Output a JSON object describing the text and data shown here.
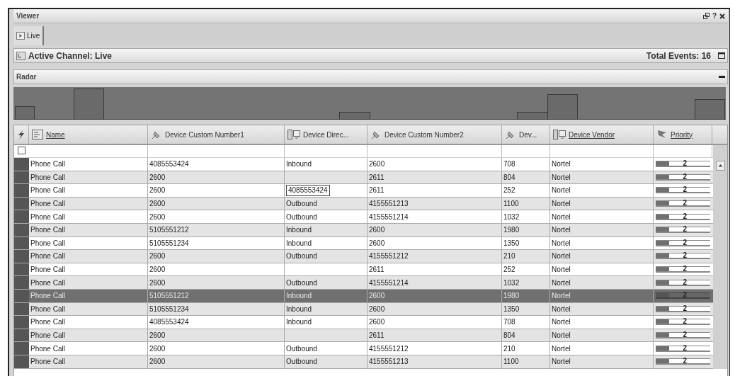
{
  "window": {
    "title": "Viewer",
    "help": "?"
  },
  "tabs": [
    {
      "label": "Live",
      "selected": true
    }
  ],
  "channel_bar": {
    "label": "Active Channel: Live",
    "total": "Total Events: 16"
  },
  "radar": {
    "title": "Radar"
  },
  "table": {
    "columns": [
      {
        "label": "Name",
        "kind": "event",
        "linked": true
      },
      {
        "label": "Device Custom Number1",
        "kind": "custom",
        "linked": false
      },
      {
        "label": "Device Direc...",
        "kind": "device",
        "linked": false
      },
      {
        "label": "Device Custom Number2",
        "kind": "custom",
        "linked": false
      },
      {
        "label": "Dev...",
        "kind": "custom",
        "linked": false
      },
      {
        "label": "Device Vendor",
        "kind": "device",
        "linked": true
      },
      {
        "label": "Priority",
        "kind": "priority",
        "linked": true
      }
    ],
    "filter_row": {
      "checked": false
    },
    "rows": [
      {
        "cells": [
          "Phone Call",
          "4085553424",
          "Inbound",
          "2600",
          "708",
          "Nortel"
        ],
        "priority": {
          "level": 0.25,
          "reading": "2"
        },
        "selected": false,
        "editing": false
      },
      {
        "cells": [
          "Phone Call",
          "2600",
          "",
          "2611",
          "804",
          "Nortel"
        ],
        "priority": {
          "level": 0.25,
          "reading": "2"
        },
        "selected": false,
        "editing": false
      },
      {
        "cells": [
          "Phone Call",
          "2600",
          "4085553424",
          "2611",
          "252",
          "Nortel"
        ],
        "priority": {
          "level": 0.25,
          "reading": "2"
        },
        "selected": false,
        "editing": true
      },
      {
        "cells": [
          "Phone Call",
          "2600",
          "Outbound",
          "4155551213",
          "1100",
          "Nortel"
        ],
        "priority": {
          "level": 0.25,
          "reading": "2"
        },
        "selected": false,
        "editing": false
      },
      {
        "cells": [
          "Phone Call",
          "2600",
          "Outbound",
          "4155551214",
          "1032",
          "Nortel"
        ],
        "priority": {
          "level": 0.25,
          "reading": "2"
        },
        "selected": false,
        "editing": false
      },
      {
        "cells": [
          "Phone Call",
          "5105551212",
          "Inbound",
          "2600",
          "1980",
          "Nortel"
        ],
        "priority": {
          "level": 0.25,
          "reading": "2"
        },
        "selected": false,
        "editing": false
      },
      {
        "cells": [
          "Phone Call",
          "5105551234",
          "Inbound",
          "2600",
          "1350",
          "Nortel"
        ],
        "priority": {
          "level": 0.25,
          "reading": "2"
        },
        "selected": false,
        "editing": false
      },
      {
        "cells": [
          "Phone Call",
          "2600",
          "Outbound",
          "4155551212",
          "210",
          "Nortel"
        ],
        "priority": {
          "level": 0.25,
          "reading": "2"
        },
        "selected": false,
        "editing": false
      },
      {
        "cells": [
          "Phone Call",
          "2600",
          "",
          "2611",
          "252",
          "Nortel"
        ],
        "priority": {
          "level": 0.25,
          "reading": "2"
        },
        "selected": false,
        "editing": false
      },
      {
        "cells": [
          "Phone Call",
          "2600",
          "Outbound",
          "4155551214",
          "1032",
          "Nortel"
        ],
        "priority": {
          "level": 0.25,
          "reading": "2"
        },
        "selected": false,
        "editing": false
      },
      {
        "cells": [
          "Phone Call",
          "5105551212",
          "Inbound",
          "2600",
          "1980",
          "Nortel"
        ],
        "priority": {
          "level": 0.25,
          "reading": "2"
        },
        "selected": true,
        "editing": false
      },
      {
        "cells": [
          "Phone Call",
          "5105551234",
          "Inbound",
          "2600",
          "1350",
          "Nortel"
        ],
        "priority": {
          "level": 0.25,
          "reading": "2"
        },
        "selected": false,
        "editing": false
      },
      {
        "cells": [
          "Phone Call",
          "4085553424",
          "Inbound",
          "2600",
          "708",
          "Nortel"
        ],
        "priority": {
          "level": 0.25,
          "reading": "2"
        },
        "selected": false,
        "editing": false
      },
      {
        "cells": [
          "Phone Call",
          "2600",
          "",
          "2611",
          "804",
          "Nortel"
        ],
        "priority": {
          "level": 0.25,
          "reading": "2"
        },
        "selected": false,
        "editing": false
      },
      {
        "cells": [
          "Phone Call",
          "2600",
          "Outbound",
          "4155551212",
          "210",
          "Nortel"
        ],
        "priority": {
          "level": 0.25,
          "reading": "2"
        },
        "selected": false,
        "editing": false
      },
      {
        "cells": [
          "Phone Call",
          "2600",
          "Outbound",
          "4155551213",
          "1100",
          "Nortel"
        ],
        "priority": {
          "level": 0.25,
          "reading": "2"
        },
        "selected": false,
        "editing": false
      }
    ]
  }
}
